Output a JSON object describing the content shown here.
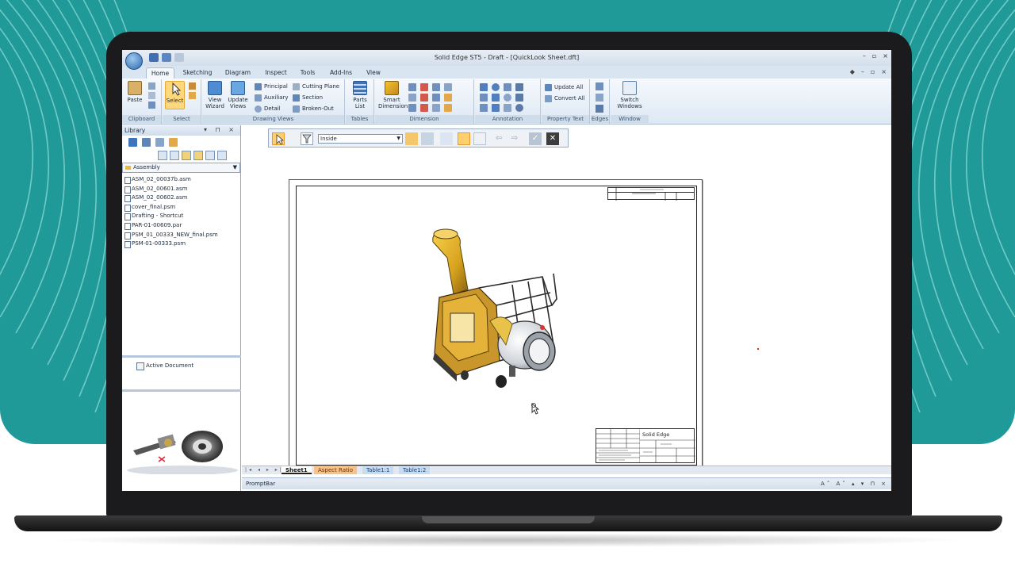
{
  "window": {
    "title": "Solid Edge ST5 - Draft - [QuickLook Sheet.dft]",
    "controls": [
      "–",
      "▫",
      "×"
    ]
  },
  "ribbon": {
    "tabs": [
      "Home",
      "Sketching",
      "Diagram",
      "Inspect",
      "Tools",
      "Add-Ins",
      "View"
    ],
    "active_tab": "Home",
    "groups": {
      "clipboard": {
        "label": "Clipboard",
        "paste": "Paste"
      },
      "select": {
        "label": "Select",
        "select": "Select"
      },
      "drawing_views": {
        "label": "Drawing Views",
        "view_wizard": "View Wizard",
        "update_views": "Update Views",
        "principal": "Principal",
        "auxiliary": "Auxiliary",
        "detail": "Detail",
        "cutting_plane": "Cutting Plane",
        "section": "Section",
        "broken_out": "Broken-Out"
      },
      "tables": {
        "label": "Tables",
        "parts_list": "Parts List"
      },
      "dimension": {
        "label": "Dimension",
        "smart_dimension": "Smart Dimension"
      },
      "annotation": {
        "label": "Annotation"
      },
      "property_text": {
        "label": "Property Text",
        "update_all": "Update All",
        "convert_all": "Convert All"
      },
      "edges": {
        "label": "Edges"
      },
      "window": {
        "label": "Window",
        "switch_windows": "Switch Windows"
      }
    }
  },
  "library": {
    "title": "Library",
    "folder": "Assembly",
    "files": [
      "ASM_02_00037b.asm",
      "ASM_02_00601.asm",
      "ASM_02_00602.asm",
      "cover_final.psm",
      "Drafting - Shortcut",
      "PAR-01-00609.par",
      "PSM_01_00333_NEW_final.psm",
      "PSM-01-00333.psm"
    ],
    "active_document": "Active Document"
  },
  "toolbar": {
    "select_value": "Inside"
  },
  "sheet": {
    "title_block_name": "Solid Edge"
  },
  "sheet_tabs": [
    "Sheet1",
    "Aspect Ratio",
    "Table1:1",
    "Table1:2"
  ],
  "promptbar": {
    "label": "PromptBar"
  },
  "colors": {
    "background_teal": "#1f9a98",
    "ribbon_blue": "#dae5f2",
    "selected_orange": "#ffd87e",
    "model_gold": "#d9a41f"
  }
}
